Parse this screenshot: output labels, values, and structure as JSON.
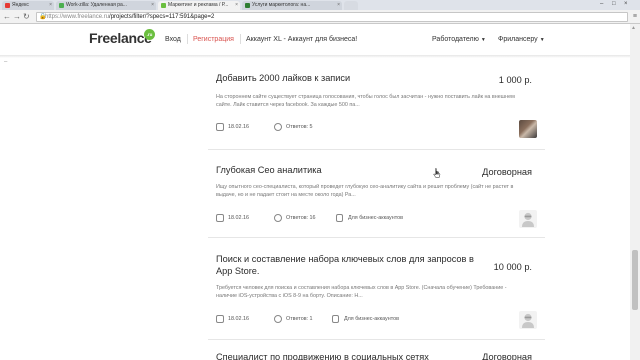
{
  "browser": {
    "tabs": [
      {
        "label": "Яндекс",
        "active": false
      },
      {
        "label": "Work-zilla: Удаленная ра...",
        "active": false
      },
      {
        "label": "Маркетинг и реклама / Р...",
        "active": true
      },
      {
        "label": "Услуги маркетолога: на...",
        "active": false
      }
    ],
    "url_host": "https://www.freelance.ru",
    "url_path": "/projects/filter/?specs=117:591&page=2"
  },
  "header": {
    "logo_text": "Freelance",
    "logo_badge": ".ru",
    "login": "Вход",
    "register": "Регистрация",
    "account_promo": "Аккаунт XL - Аккаунт для бизнеса!",
    "employer_menu": "Работодателю",
    "freelancer_menu": "Фрилансеру"
  },
  "projects": [
    {
      "title": "Добавить 2000 лайков к записи",
      "price": "1 000 р.",
      "description": "На стороннем сайте существует страница голосования, чтобы голос был засчитан - нужно поставить лайк на внешнем сайте. Лайк ставится через facebook. За каждые 500 па...",
      "date": "18.02.16",
      "answers": "Ответов: 5",
      "business": "",
      "avatar": "photo"
    },
    {
      "title": "Глубокая Сео аналитика",
      "price": "Договорная",
      "description": "Ищу опытного сео-специалиста, который проведет глубокую сео-аналитику сайта и решит проблему (сайт не растет в выдаче, но и не падает стоит на месте около года) Ра...",
      "date": "18.02.16",
      "answers": "Ответов: 16",
      "business": "Для бизнес-аккаунтов",
      "avatar": "placeholder"
    },
    {
      "title": "Поиск и составление набора ключевых слов для запросов в App Store.",
      "price": "10 000 р.",
      "description": "Требуется человек для поиска и составления набора ключевых слов в App Store. (Сначала обучение) Требование - наличие iOS-устройства с iOS 8-9 на борту. Описание: Н...",
      "date": "18.02.16",
      "answers": "Ответов: 1",
      "business": "Для бизнес-аккаунтов",
      "avatar": "placeholder"
    },
    {
      "title": "Специалист по продвижению в социальных сетях",
      "price": "Договорная",
      "description": "",
      "date": "",
      "answers": "",
      "business": "",
      "avatar": "none"
    }
  ],
  "colors": {
    "brand_green": "#6bbf3f",
    "register_red": "#d9534f"
  },
  "icons": {
    "calendar": "calendar-icon",
    "answers": "comment-icon",
    "business": "briefcase-icon"
  }
}
